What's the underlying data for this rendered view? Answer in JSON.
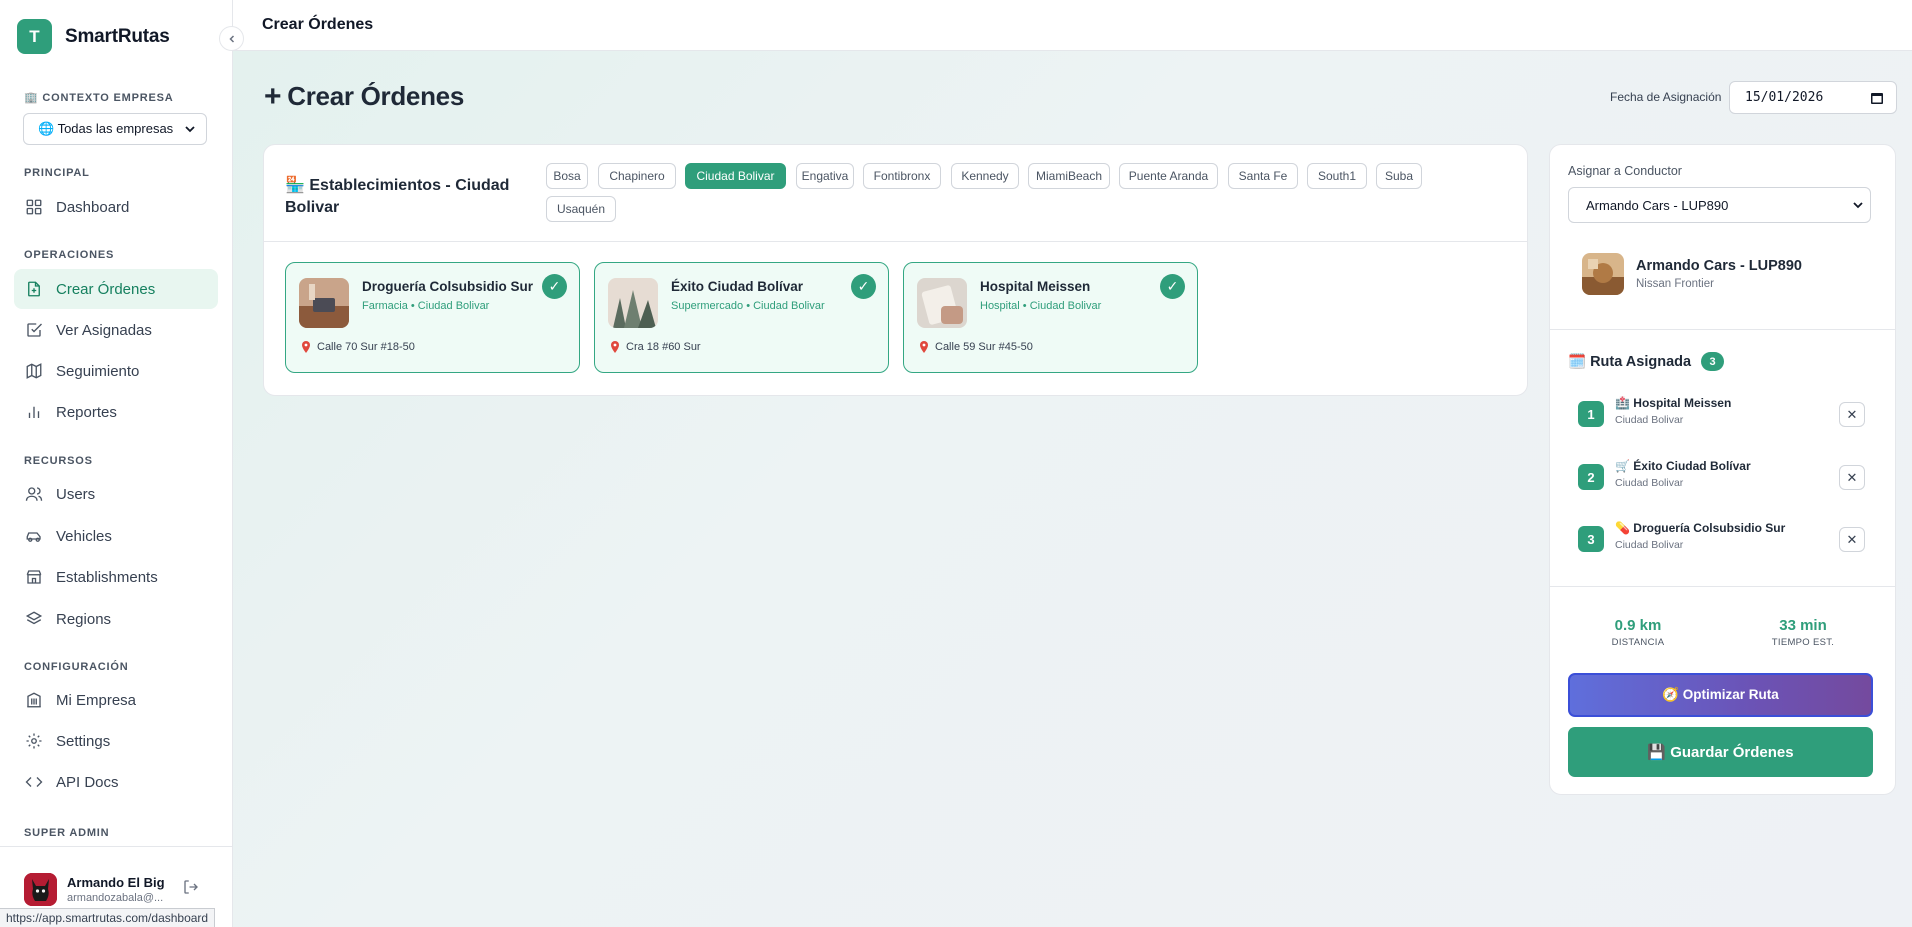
{
  "brand": {
    "logo_letter": "T",
    "name": "SmartRutas"
  },
  "sidebar": {
    "context_label": "🏢 CONTEXTO EMPRESA",
    "company_select": "🌐 Todas las empresas",
    "sections": {
      "principal": "PRINCIPAL",
      "operaciones": "OPERACIONES",
      "recursos": "RECURSOS",
      "configuracion": "CONFIGURACIÓN",
      "super_admin": "SUPER ADMIN"
    },
    "items": [
      {
        "label": "Dashboard",
        "icon": "grid-icon"
      },
      {
        "label": "Crear Órdenes",
        "icon": "file-plus-icon",
        "active": true
      },
      {
        "label": "Ver Asignadas",
        "icon": "checkbox-icon"
      },
      {
        "label": "Seguimiento",
        "icon": "map-icon"
      },
      {
        "label": "Reportes",
        "icon": "bar-chart-icon"
      },
      {
        "label": "Users",
        "icon": "users-icon"
      },
      {
        "label": "Vehicles",
        "icon": "car-icon"
      },
      {
        "label": "Establishments",
        "icon": "store-icon"
      },
      {
        "label": "Regions",
        "icon": "layers-icon"
      },
      {
        "label": "Mi Empresa",
        "icon": "building-icon"
      },
      {
        "label": "Settings",
        "icon": "gear-icon"
      },
      {
        "label": "API Docs",
        "icon": "code-icon"
      }
    ],
    "user": {
      "name": "Armando El Big B",
      "email": "armandozabala@..."
    }
  },
  "status_url": "https://app.smartrutas.com/dashboard",
  "topbar": {
    "title": "Crear Órdenes"
  },
  "page": {
    "title_icon": "+",
    "title": "Crear Órdenes",
    "date_label": "Fecha de Asignación",
    "date_value": "15/01/2026"
  },
  "establishments": {
    "title": "🏪 Establecimientos - Ciudad Bolivar",
    "regions": [
      "Bosa",
      "Chapinero",
      "Ciudad Bolivar",
      "Engativa",
      "Fontibronx",
      "Kennedy",
      "MiamiBeach",
      "Puente Aranda",
      "Santa Fe",
      "South1",
      "Suba",
      "Usaquén"
    ],
    "active_region": "Ciudad Bolivar",
    "cards": [
      {
        "name": "Droguería Colsubsidio Sur",
        "subtitle": "Farmacia • Ciudad Bolivar",
        "address": "Calle 70 Sur #18-50",
        "checked": true
      },
      {
        "name": "Éxito Ciudad Bolívar",
        "subtitle": "Supermercado • Ciudad Bolivar",
        "address": "Cra 18 #60 Sur",
        "checked": true
      },
      {
        "name": "Hospital Meissen",
        "subtitle": "Hospital • Ciudad Bolivar",
        "address": "Calle 59 Sur #45-50",
        "checked": true
      }
    ],
    "check_glyph": "✓"
  },
  "assign": {
    "label": "Asignar a Conductor",
    "driver_select": "Armando Cars - LUP890",
    "driver_name": "Armando Cars - LUP890",
    "driver_vehicle": "Nissan Frontier",
    "route_title": "🗓️ Ruta Asignada",
    "route_count": "3",
    "stops": [
      {
        "num": "1",
        "name": "🏥 Hospital Meissen",
        "sub": "Ciudad Bolivar"
      },
      {
        "num": "2",
        "name": "🛒 Éxito Ciudad Bolívar",
        "sub": "Ciudad Bolivar"
      },
      {
        "num": "3",
        "name": "💊 Droguería Colsubsidio Sur",
        "sub": "Ciudad Bolivar"
      }
    ],
    "remove_glyph": "✕",
    "distance_value": "0.9 km",
    "distance_label": "DISTANCIA",
    "time_value": "33 min",
    "time_label": "TIEMPO EST.",
    "optimize_label": "🧭 Optimizar Ruta",
    "save_label": "💾 Guardar Órdenes"
  },
  "colors": {
    "accent": "#2f9e7b",
    "accent_light": "#effbf6",
    "optimize_start": "#5f6fdc",
    "optimize_end": "#744a9e"
  }
}
